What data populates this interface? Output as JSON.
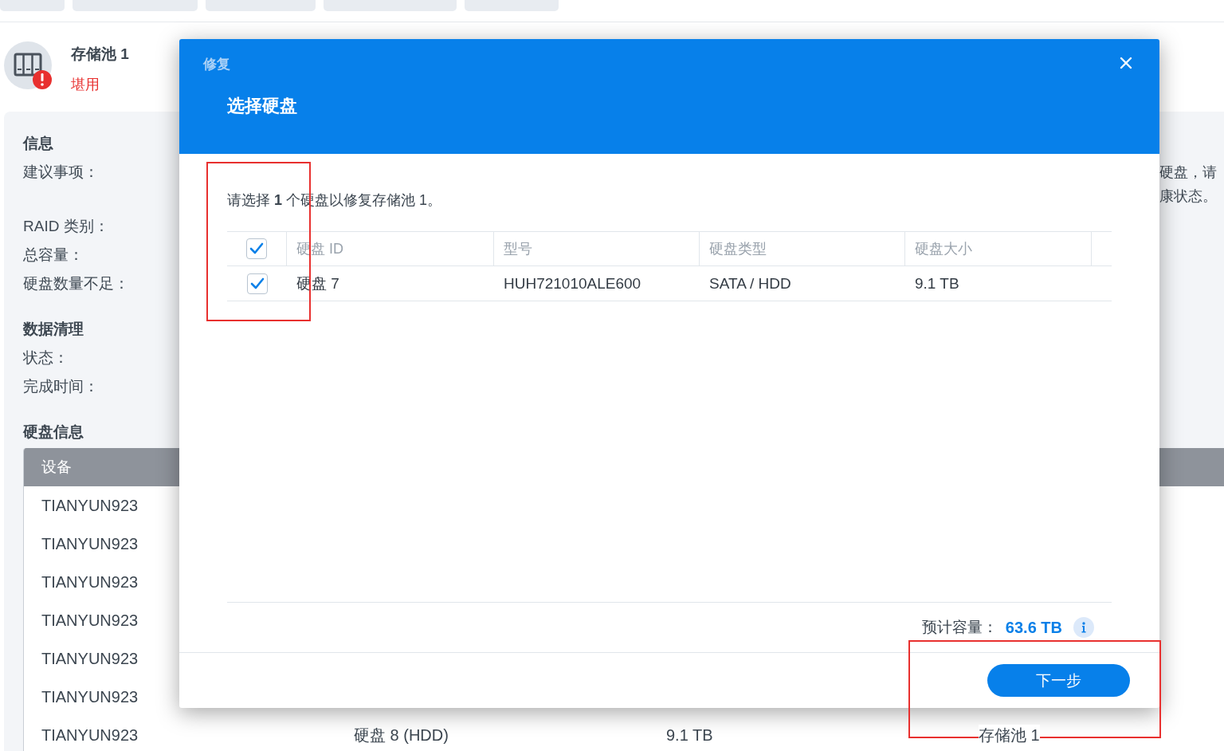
{
  "pool": {
    "name": "存储池 1",
    "status": "堪用"
  },
  "info": {
    "title": "信息",
    "rows": [
      {
        "label": "建议事项：",
        "value_lines": [
          "硬盘，请",
          "康状态。"
        ]
      },
      {
        "label": "RAID 类别："
      },
      {
        "label": "总容量："
      },
      {
        "label": "硬盘数量不足："
      }
    ]
  },
  "scrub": {
    "title": "数据清理",
    "rows": [
      {
        "label": "状态："
      },
      {
        "label": "完成时间："
      }
    ]
  },
  "disk_info": {
    "title": "硬盘信息",
    "columns": [
      "设备"
    ],
    "rows": [
      {
        "device": "TIANYUN923"
      },
      {
        "device": "TIANYUN923"
      },
      {
        "device": "TIANYUN923"
      },
      {
        "device": "TIANYUN923"
      },
      {
        "device": "TIANYUN923"
      },
      {
        "device": "TIANYUN923"
      },
      {
        "device": "TIANYUN923",
        "disk": "硬盘 8 (HDD)",
        "size": "9.1 TB",
        "pool": "存储池 1"
      }
    ]
  },
  "dialog": {
    "window_title": "修复",
    "step_title": "选择硬盘",
    "instruction": "请选择 **1** 个硬盘以修复存储池 1。",
    "select_all": {
      "checked": true
    },
    "columns": [
      "硬盘 ID",
      "型号",
      "硬盘类型",
      "硬盘大小"
    ],
    "rows": [
      {
        "checked": true,
        "disk_id": "硬盘 7",
        "model": "HUH721010ALE600",
        "type": "SATA / HDD",
        "size": "9.1 TB"
      }
    ],
    "capacity_label": "预计容量：",
    "capacity_value": "63.6 TB",
    "next_button": "下一步"
  },
  "annotations": [
    {
      "kind": "highlight"
    },
    {
      "kind": "highlight"
    }
  ]
}
